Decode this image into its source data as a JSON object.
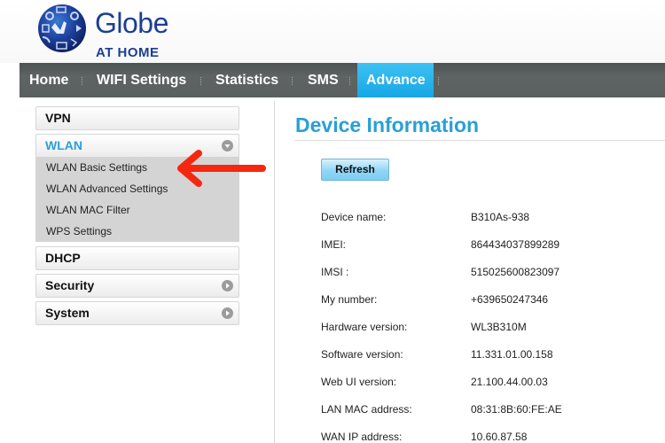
{
  "brand": {
    "name": "Globe",
    "tagline": "AT HOME",
    "logo_icon": "globe-at-home-logo",
    "color": "#1c3f94"
  },
  "nav": {
    "items": [
      {
        "label": "Home",
        "active": false
      },
      {
        "label": "WIFI Settings",
        "active": false
      },
      {
        "label": "Statistics",
        "active": false
      },
      {
        "label": "SMS",
        "active": false
      },
      {
        "label": "Advance",
        "active": true
      }
    ],
    "active_color": "#1aa9e8"
  },
  "sidebar": {
    "items": [
      {
        "label": "VPN",
        "state": "none"
      },
      {
        "label": "WLAN",
        "state": "expanded",
        "icon": "chevron-down-icon"
      },
      {
        "label": "DHCP",
        "state": "none"
      },
      {
        "label": "Security",
        "state": "collapsed",
        "icon": "chevron-right-icon"
      },
      {
        "label": "System",
        "state": "collapsed",
        "icon": "chevron-right-icon"
      }
    ],
    "submenu": [
      {
        "label": "WLAN Basic Settings"
      },
      {
        "label": "WLAN Advanced Settings"
      },
      {
        "label": "WLAN MAC Filter"
      },
      {
        "label": "WPS Settings"
      }
    ]
  },
  "annotation": {
    "type": "red-arrow-pointing-left",
    "color": "#f5280f",
    "target": "WLAN Basic Settings"
  },
  "main": {
    "title": "Device Information",
    "refresh_label": "Refresh",
    "rows": [
      {
        "label": "Device name:",
        "value": "B310As-938"
      },
      {
        "label": "IMEI:",
        "value": "864434037899289"
      },
      {
        "label": "IMSI :",
        "value": "515025600823097"
      },
      {
        "label": "My number:",
        "value": "+639650247346"
      },
      {
        "label": "Hardware version:",
        "value": "WL3B310M"
      },
      {
        "label": "Software version:",
        "value": "11.331.01.00.158"
      },
      {
        "label": "Web UI version:",
        "value": "21.100.44.00.03"
      },
      {
        "label": "LAN MAC address:",
        "value": "08:31:8B:60:FE:AE"
      },
      {
        "label": "WAN IP address:",
        "value": "10.60.87.58"
      }
    ]
  }
}
